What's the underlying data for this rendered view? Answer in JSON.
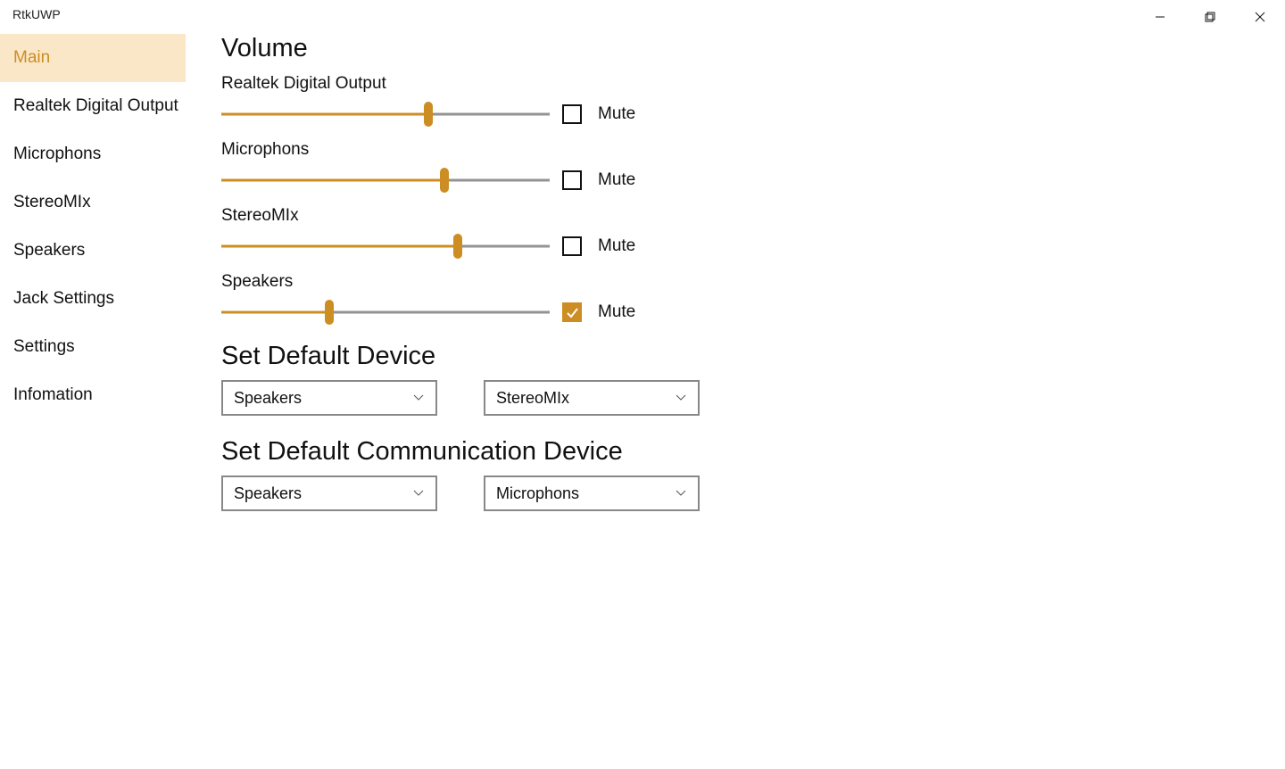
{
  "window": {
    "title": "RtkUWP"
  },
  "accent_color": "#cc8d22",
  "sidebar": {
    "items": [
      {
        "label": "Main",
        "active": true
      },
      {
        "label": "Realtek Digital Output",
        "active": false
      },
      {
        "label": "Microphons",
        "active": false
      },
      {
        "label": "StereoMIx",
        "active": false
      },
      {
        "label": "Speakers",
        "active": false
      },
      {
        "label": "Jack Settings",
        "active": false
      },
      {
        "label": "Settings",
        "active": false
      },
      {
        "label": "Infomation",
        "active": false
      }
    ]
  },
  "main": {
    "volume_heading": "Volume",
    "volumes": [
      {
        "name": "Realtek Digital Output",
        "value": 63,
        "mute_label": "Mute",
        "muted": false
      },
      {
        "name": "Microphons",
        "value": 68,
        "mute_label": "Mute",
        "muted": false
      },
      {
        "name": "StereoMIx",
        "value": 72,
        "mute_label": "Mute",
        "muted": false
      },
      {
        "name": "Speakers",
        "value": 33,
        "mute_label": "Mute",
        "muted": true
      }
    ],
    "default_device_heading": "Set Default Device",
    "default_device": {
      "output_selected": "Speakers",
      "input_selected": "StereoMIx"
    },
    "default_comm_heading": "Set Default Communication Device",
    "default_comm": {
      "output_selected": "Speakers",
      "input_selected": "Microphons"
    }
  }
}
